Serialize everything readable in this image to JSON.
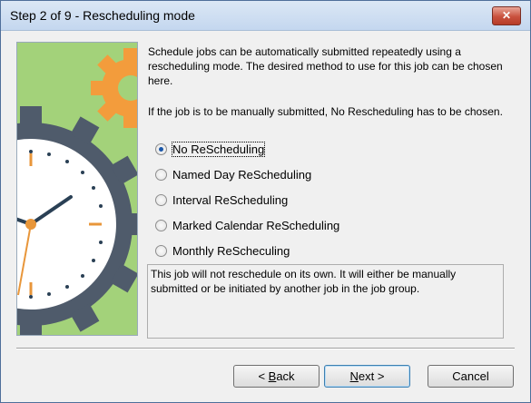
{
  "window": {
    "title": "Step 2 of 9 - Rescheduling mode",
    "close_label": "✕"
  },
  "intro": {
    "paragraph1": "Schedule jobs can be automatically submitted repeatedly using a rescheduling mode. The desired method to use for this job can be chosen here.",
    "paragraph2": "If the job is to be manually submitted, No Rescheduling has to be chosen."
  },
  "options": [
    {
      "label": "No ReScheduling",
      "selected": true
    },
    {
      "label": "Named Day ReScheduling",
      "selected": false
    },
    {
      "label": "Interval ReScheduling",
      "selected": false
    },
    {
      "label": "Marked Calendar ReScheduling",
      "selected": false
    },
    {
      "label": "Monthly ReScheculing",
      "selected": false
    }
  ],
  "description": "This job will not reschedule on its own. It will either be manually submitted or be initiated by another job in the job group.",
  "buttons": {
    "back_prefix": "< ",
    "back_mnemonic": "B",
    "back_rest": "ack",
    "next_mnemonic": "N",
    "next_rest": "ext >",
    "cancel": "Cancel"
  },
  "illustration": {
    "background_color": "#a3d27a",
    "gear_colors": [
      "#f39c3c",
      "#4f5b6b"
    ],
    "clock_face_color": "#ffffff",
    "clock_hand_color": "#2a4055",
    "accent_color": "#e8963a"
  }
}
